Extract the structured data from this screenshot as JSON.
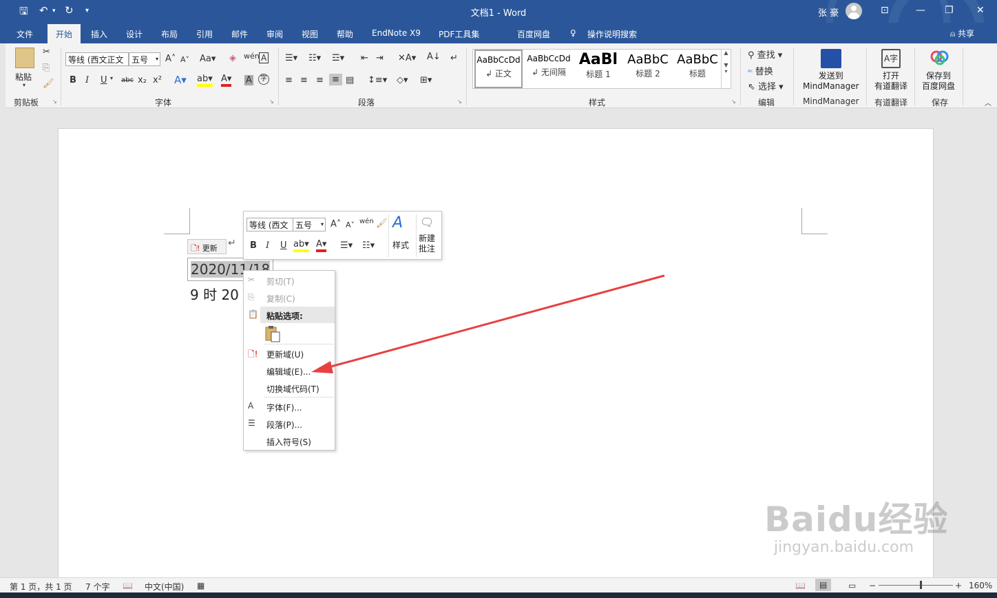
{
  "title_bar": {
    "document_title": "文档1  -  Word",
    "user_name": "张 豪",
    "quick_access": {
      "save_icon": "save-icon",
      "undo_icon": "undo-icon",
      "redo_icon": "redo-icon",
      "customize_icon": "customize-icon"
    }
  },
  "tabs": [
    "文件",
    "开始",
    "插入",
    "设计",
    "布局",
    "引用",
    "邮件",
    "审阅",
    "视图",
    "帮助",
    "EndNote X9",
    "PDF工具集",
    "百度网盘"
  ],
  "tell_me": "操作说明搜索",
  "share_label": "共享",
  "ribbon": {
    "clipboard": {
      "paste": "粘贴",
      "label": "剪贴板"
    },
    "font": {
      "font_name": "等线 (西文正文",
      "font_size": "五号",
      "label": "字体"
    },
    "paragraph": {
      "label": "段落"
    },
    "styles": {
      "label": "样式",
      "items": [
        {
          "preview": "AaBbCcDd",
          "name": "↲ 正文"
        },
        {
          "preview": "AaBbCcDd",
          "name": "↲ 无间隔"
        },
        {
          "preview": "AaBl",
          "name": "标题 1"
        },
        {
          "preview": "AaBbC",
          "name": "标题 2"
        },
        {
          "preview": "AaBbC",
          "name": "标题"
        }
      ]
    },
    "editing": {
      "find": "查找",
      "replace": "替换",
      "select": "选择",
      "label": "编辑"
    },
    "mindmanager": {
      "button": "发送到\nMindManager",
      "label": "MindManager"
    },
    "youdao": {
      "button": "打开\n有道翻译",
      "label": "有道翻译"
    },
    "baidu": {
      "button": "保存到\n百度网盘",
      "label": "保存"
    }
  },
  "document": {
    "update_tag": "更新",
    "date_text": "2020/11/18",
    "time_text": "9 时 20"
  },
  "mini_toolbar": {
    "font_name": "等线 (西文",
    "font_size": "五号",
    "styles_label": "样式",
    "new_comment": "新建\n批注"
  },
  "context_menu": {
    "cut": "剪切(T)",
    "copy": "复制(C)",
    "paste_options": "粘贴选项:",
    "update_field": "更新域(U)",
    "edit_field": "编辑域(E)...",
    "toggle_codes": "切换域代码(T)",
    "font": "字体(F)...",
    "paragraph": "段落(P)...",
    "insert_symbol": "插入符号(S)"
  },
  "status_bar": {
    "page": "第 1 页，共 1 页",
    "words": "7 个字",
    "language": "中文(中国)",
    "zoom": "160%"
  },
  "watermark": {
    "brand": "Baidu经验",
    "url": "jingyan.baidu.com"
  },
  "colors": {
    "word_blue": "#2b579a",
    "arrow_red": "#e84040"
  }
}
